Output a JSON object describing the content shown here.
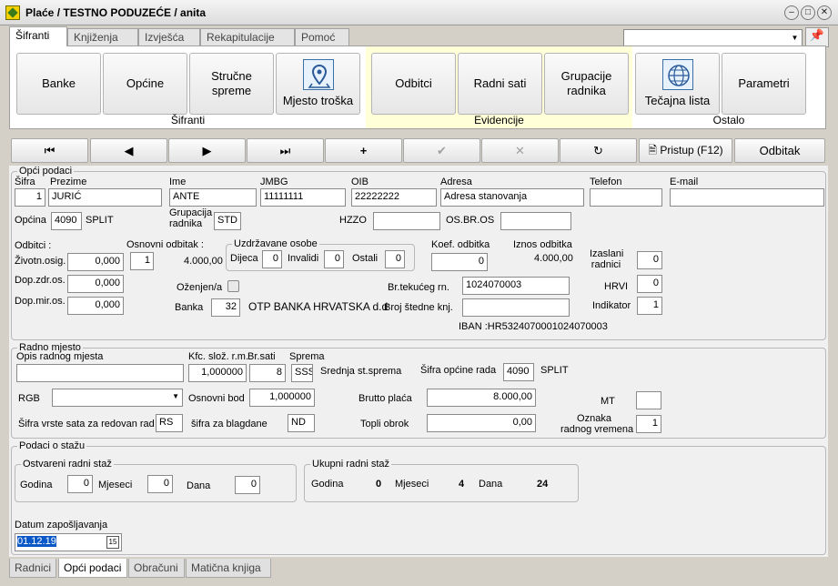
{
  "window": {
    "title": "Plaće / TESTNO PODUZEĆE / anita"
  },
  "tabs": [
    "Šifranti",
    "Knjiženja",
    "Izvješća",
    "Rekapitulacije",
    "Pomoć"
  ],
  "ribbon": {
    "groups": [
      "Šifranti",
      "Evidencije",
      "Ostalo"
    ],
    "sifranti": [
      "Banke",
      "Općine",
      "Stručne spreme",
      "Mjesto troška"
    ],
    "evidencije": [
      "Odbitci",
      "Radni sati",
      "Grupacije radnika"
    ],
    "ostalo": [
      "Tečajna lista",
      "Parametri"
    ]
  },
  "nav": {
    "pristup": "Pristup (F12)",
    "odbitak": "Odbitak"
  },
  "opci": {
    "legend": "Opći podaci",
    "labels": {
      "sifra": "Šifra",
      "prezime": "Prezime",
      "ime": "Ime",
      "jmbg": "JMBG",
      "oib": "OIB",
      "adresa": "Adresa",
      "telefon": "Telefon",
      "email": "E-mail",
      "opcina": "Općina",
      "grupacija": "Grupacija radnika",
      "hzzo": "HZZO",
      "osbr": "OS.BR.OS"
    },
    "sifra": "1",
    "prezime": "JURIĆ",
    "ime": "ANTE",
    "jmbg": "11111111",
    "oib": "22222222",
    "adresa": "Adresa stanovanja",
    "telefon": "",
    "email": "",
    "opcina_code": "4090",
    "opcina_name": "SPLIT",
    "grupacija": "STD",
    "hzzo": "",
    "osbr": "",
    "odbitci_lbl": "Odbitci :",
    "zivot_lbl": "Životn.osig.",
    "zivot": "0,000",
    "dopzdr_lbl": "Dop.zdr.os.",
    "dopzdr": "0,000",
    "dopmir_lbl": "Dop.mir.os.",
    "dopmir": "0,000",
    "osn_lbl": "Osnovni odbitak :",
    "osn_val": "1",
    "osn_amt": "4.000,00",
    "uzd_lbl": "Uzdržavane osobe",
    "djeca_lbl": "Dijeca",
    "djeca": "0",
    "inval_lbl": "Invalidi",
    "inval": "0",
    "ostali_lbl": "Ostali",
    "ostali": "0",
    "koef_lbl": "Koef. odbitka",
    "koef": "0",
    "iznos_lbl": "Iznos odbitka",
    "iznos": "4.000,00",
    "izasl_lbl": "Izaslani radnici",
    "izasl": "0",
    "hrvi_lbl": "HRVI",
    "hrvi": "0",
    "ind_lbl": "Indikator",
    "ind": "1",
    "ozenjen_lbl": "Oženjen/a",
    "banka_lbl": "Banka",
    "banka_code": "32",
    "banka_name": "OTP BANKA HRVATSKA d.d",
    "tekuci_lbl": "Br.tekućeg rn.",
    "tekuci": "1024070003",
    "stedna_lbl": "Broj štedne knj.",
    "stedna": "",
    "iban": "IBAN :HR5324070001024070003"
  },
  "radno": {
    "legend": "Radno mjesto",
    "opis_lbl": "Opis radnog mjesta",
    "opis": "",
    "kfc_lbl": "Kfc. slož. r.m.",
    "kfc": "1,000000",
    "brsati_lbl": "Br.sati",
    "brsati": "8",
    "sprema_lbl": "Sprema",
    "sprema_code": "SSS",
    "sprema_name": "Srednja st.sprema",
    "opc_rada_lbl": "Šifra općine rada",
    "opc_rada": "4090",
    "opc_rada_name": "SPLIT",
    "rgb_lbl": "RGB",
    "rgb": "",
    "osnbod_lbl": "Osnovni bod",
    "osnbod": "1,000000",
    "brutto_lbl": "Brutto plaća",
    "brutto": "8.000,00",
    "mt_lbl": "MT",
    "mt": "",
    "vrsta_lbl": "Šifra vrste sata za redovan rad",
    "vrsta": "RS",
    "blagdan_lbl": "šifra za blagdane",
    "blagdan": "ND",
    "topli_lbl": "Topli obrok",
    "topli": "0,00",
    "oznaka_lbl1": "Oznaka",
    "oznaka_lbl2": "radnog vremena",
    "oznaka": "1"
  },
  "staz": {
    "legend": "Podaci o stažu",
    "ostv_legend": "Ostvareni radni staž",
    "ukup_legend": "Ukupni radni staž",
    "godina_lbl": "Godina",
    "mjeseci_lbl": "Mjeseci",
    "dana_lbl": "Dana",
    "ostv_god": "0",
    "ostv_mj": "0",
    "ostv_dana": "0",
    "uk_god": "0",
    "uk_mj": "4",
    "uk_dana": "24",
    "datum_lbl": "Datum zapošljavanja",
    "datum": "01.12.19",
    "cal": "15"
  },
  "bottom_tabs": [
    "Radnici",
    "Opći podaci",
    "Obračuni",
    "Matična knjiga"
  ]
}
